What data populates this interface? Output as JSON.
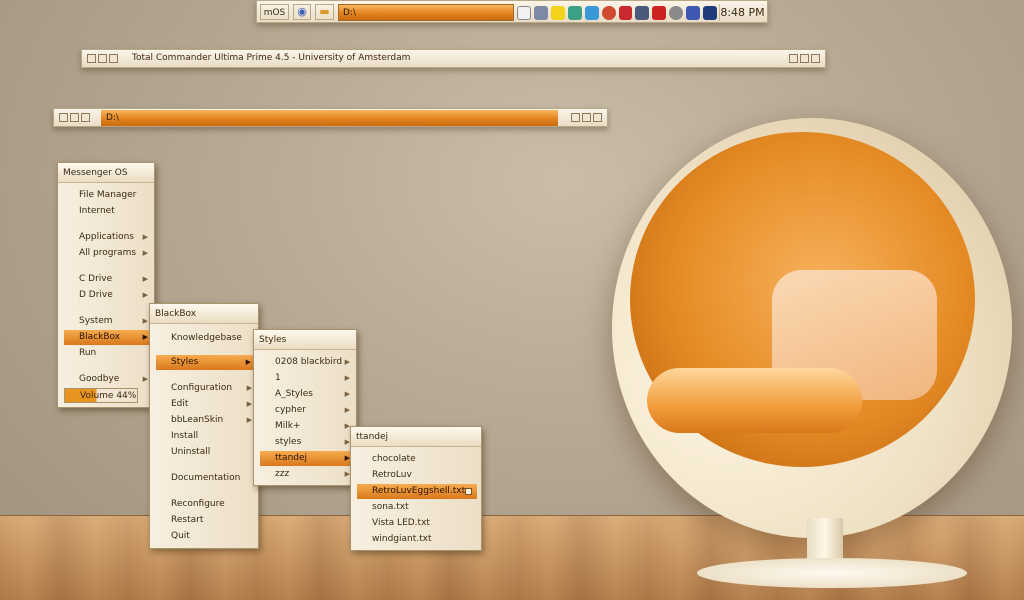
{
  "toolbar": {
    "start_label": "mOS",
    "path": "D:\\",
    "clock": "8:48 PM"
  },
  "tc_window": {
    "title": "Total Commander Ultima Prime 4.5 - University of Amsterdam"
  },
  "path_window": {
    "path": "D:\\"
  },
  "main_menu": {
    "title": "Messenger OS",
    "items": [
      {
        "label": "File Manager"
      },
      {
        "label": "Internet"
      },
      {
        "label": "Applications"
      },
      {
        "label": "All programs"
      },
      {
        "label": "C Drive"
      },
      {
        "label": "D Drive"
      },
      {
        "label": "System"
      },
      {
        "label": "BlackBox"
      },
      {
        "label": "Run"
      },
      {
        "label": "Goodbye"
      },
      {
        "label": "Volume 44%"
      }
    ],
    "volume_percent": 44
  },
  "blackbox_menu": {
    "title": "BlackBox",
    "items": [
      {
        "label": "Knowledgebase"
      },
      {
        "label": "Styles"
      },
      {
        "label": "Configuration"
      },
      {
        "label": "Edit"
      },
      {
        "label": "bbLeanSkin"
      },
      {
        "label": "Install"
      },
      {
        "label": "Uninstall"
      },
      {
        "label": "Documentation"
      },
      {
        "label": "Reconfigure"
      },
      {
        "label": "Restart"
      },
      {
        "label": "Quit"
      }
    ]
  },
  "styles_menu": {
    "title": "Styles",
    "items": [
      {
        "label": "0208 blackbird"
      },
      {
        "label": "1"
      },
      {
        "label": "A_Styles"
      },
      {
        "label": "cypher"
      },
      {
        "label": "Milk+"
      },
      {
        "label": "styles"
      },
      {
        "label": "ttandej"
      },
      {
        "label": "zzz"
      }
    ]
  },
  "ttandej_menu": {
    "title": "ttandej",
    "items": [
      {
        "label": "chocolate"
      },
      {
        "label": "RetroLuv"
      },
      {
        "label": "RetroLuvEggshell.txt"
      },
      {
        "label": "sona.txt"
      },
      {
        "label": "Vista LED.txt"
      },
      {
        "label": "windgiant.txt"
      }
    ]
  },
  "tray_icons": [
    "skype-icon",
    "network-icon",
    "warning-icon",
    "sync-icon",
    "download-icon",
    "hand-icon",
    "media-icon",
    "speaker-icon",
    "mute-icon",
    "disc-icon",
    "mouse-icon",
    "shield-icon"
  ],
  "colors": {
    "accent": "#e28420",
    "panel": "#f4ead8"
  }
}
